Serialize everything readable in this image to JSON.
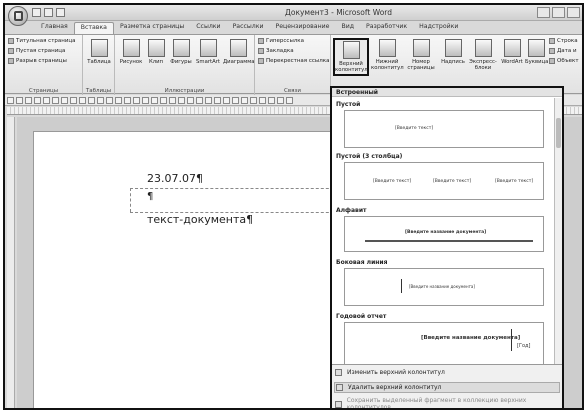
{
  "window": {
    "title": "Документ3 - Microsoft Word"
  },
  "tabs": [
    "Главная",
    "Вставка",
    "Разметка страницы",
    "Ссылки",
    "Рассылки",
    "Рецензирование",
    "Вид",
    "Разработчик",
    "Надстройки"
  ],
  "active_tab": "Вставка",
  "ribbon": {
    "pages_group": {
      "label": "Страницы",
      "items": [
        "Титульная страница",
        "Пустая страница",
        "Разрыв страницы"
      ]
    },
    "tables_group": {
      "label": "Таблицы",
      "button": "Таблица"
    },
    "illustrations_group": {
      "label": "Иллюстрации",
      "buttons": [
        "Рисунок",
        "Клип",
        "Фигуры",
        "SmartArt",
        "Диаграмма"
      ]
    },
    "links_group": {
      "label": "Связи",
      "items": [
        "Гиперссылка",
        "Закладка",
        "Перекрестная ссылка"
      ]
    },
    "header_group": {
      "buttons": [
        "Верхний колонтитул",
        "Нижний колонтитул",
        "Номер страницы"
      ]
    },
    "text_group": {
      "buttons": [
        "Надпись",
        "Экспресс-блоки",
        "WordArt",
        "Буквица"
      ],
      "items": [
        "Строка",
        "Дата и",
        "Объект"
      ]
    }
  },
  "document": {
    "date": "23.07.07¶",
    "pilcrow": "¶",
    "body": "текст-документа¶"
  },
  "gallery": {
    "header": "Встроенный",
    "templates": [
      {
        "name": "Пустой",
        "placeholders": [
          "[Введите текст]"
        ]
      },
      {
        "name": "Пустой (3 столбца)",
        "placeholders": [
          "[Введите текст]",
          "[Введите текст]",
          "[Введите текст]"
        ]
      },
      {
        "name": "Алфавит",
        "placeholders": [
          "[Введите название документа]"
        ]
      },
      {
        "name": "Боковая линия",
        "placeholders": [
          "[Введите название документа]"
        ]
      },
      {
        "name": "Годовой отчет",
        "placeholders": [
          "[Введите название документа]",
          "[Год]"
        ]
      }
    ],
    "footer": {
      "edit": "Изменить верхний колонтитул",
      "remove": "Удалить верхний колонтитул",
      "save": "Сохранить выделенный фрагмент в коллекцию верхних колонтитулов..."
    }
  }
}
